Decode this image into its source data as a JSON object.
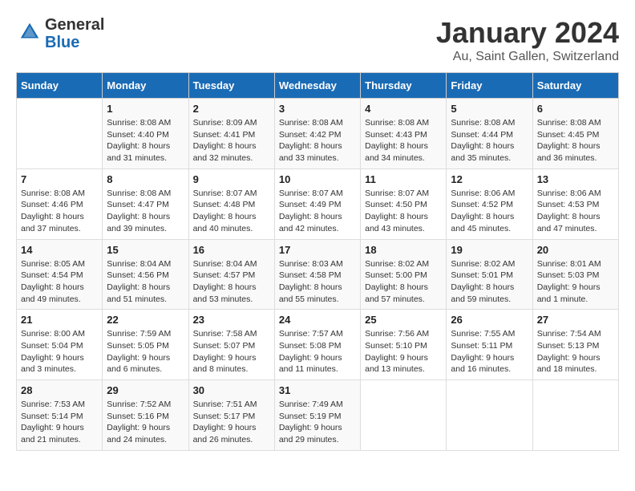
{
  "header": {
    "logo_line1": "General",
    "logo_line2": "Blue",
    "title": "January 2024",
    "subtitle": "Au, Saint Gallen, Switzerland"
  },
  "days_of_week": [
    "Sunday",
    "Monday",
    "Tuesday",
    "Wednesday",
    "Thursday",
    "Friday",
    "Saturday"
  ],
  "weeks": [
    [
      {
        "day": "",
        "sunrise": "",
        "sunset": "",
        "daylight": ""
      },
      {
        "day": "1",
        "sunrise": "Sunrise: 8:08 AM",
        "sunset": "Sunset: 4:40 PM",
        "daylight": "Daylight: 8 hours and 31 minutes."
      },
      {
        "day": "2",
        "sunrise": "Sunrise: 8:09 AM",
        "sunset": "Sunset: 4:41 PM",
        "daylight": "Daylight: 8 hours and 32 minutes."
      },
      {
        "day": "3",
        "sunrise": "Sunrise: 8:08 AM",
        "sunset": "Sunset: 4:42 PM",
        "daylight": "Daylight: 8 hours and 33 minutes."
      },
      {
        "day": "4",
        "sunrise": "Sunrise: 8:08 AM",
        "sunset": "Sunset: 4:43 PM",
        "daylight": "Daylight: 8 hours and 34 minutes."
      },
      {
        "day": "5",
        "sunrise": "Sunrise: 8:08 AM",
        "sunset": "Sunset: 4:44 PM",
        "daylight": "Daylight: 8 hours and 35 minutes."
      },
      {
        "day": "6",
        "sunrise": "Sunrise: 8:08 AM",
        "sunset": "Sunset: 4:45 PM",
        "daylight": "Daylight: 8 hours and 36 minutes."
      }
    ],
    [
      {
        "day": "7",
        "sunrise": "Sunrise: 8:08 AM",
        "sunset": "Sunset: 4:46 PM",
        "daylight": "Daylight: 8 hours and 37 minutes."
      },
      {
        "day": "8",
        "sunrise": "Sunrise: 8:08 AM",
        "sunset": "Sunset: 4:47 PM",
        "daylight": "Daylight: 8 hours and 39 minutes."
      },
      {
        "day": "9",
        "sunrise": "Sunrise: 8:07 AM",
        "sunset": "Sunset: 4:48 PM",
        "daylight": "Daylight: 8 hours and 40 minutes."
      },
      {
        "day": "10",
        "sunrise": "Sunrise: 8:07 AM",
        "sunset": "Sunset: 4:49 PM",
        "daylight": "Daylight: 8 hours and 42 minutes."
      },
      {
        "day": "11",
        "sunrise": "Sunrise: 8:07 AM",
        "sunset": "Sunset: 4:50 PM",
        "daylight": "Daylight: 8 hours and 43 minutes."
      },
      {
        "day": "12",
        "sunrise": "Sunrise: 8:06 AM",
        "sunset": "Sunset: 4:52 PM",
        "daylight": "Daylight: 8 hours and 45 minutes."
      },
      {
        "day": "13",
        "sunrise": "Sunrise: 8:06 AM",
        "sunset": "Sunset: 4:53 PM",
        "daylight": "Daylight: 8 hours and 47 minutes."
      }
    ],
    [
      {
        "day": "14",
        "sunrise": "Sunrise: 8:05 AM",
        "sunset": "Sunset: 4:54 PM",
        "daylight": "Daylight: 8 hours and 49 minutes."
      },
      {
        "day": "15",
        "sunrise": "Sunrise: 8:04 AM",
        "sunset": "Sunset: 4:56 PM",
        "daylight": "Daylight: 8 hours and 51 minutes."
      },
      {
        "day": "16",
        "sunrise": "Sunrise: 8:04 AM",
        "sunset": "Sunset: 4:57 PM",
        "daylight": "Daylight: 8 hours and 53 minutes."
      },
      {
        "day": "17",
        "sunrise": "Sunrise: 8:03 AM",
        "sunset": "Sunset: 4:58 PM",
        "daylight": "Daylight: 8 hours and 55 minutes."
      },
      {
        "day": "18",
        "sunrise": "Sunrise: 8:02 AM",
        "sunset": "Sunset: 5:00 PM",
        "daylight": "Daylight: 8 hours and 57 minutes."
      },
      {
        "day": "19",
        "sunrise": "Sunrise: 8:02 AM",
        "sunset": "Sunset: 5:01 PM",
        "daylight": "Daylight: 8 hours and 59 minutes."
      },
      {
        "day": "20",
        "sunrise": "Sunrise: 8:01 AM",
        "sunset": "Sunset: 5:03 PM",
        "daylight": "Daylight: 9 hours and 1 minute."
      }
    ],
    [
      {
        "day": "21",
        "sunrise": "Sunrise: 8:00 AM",
        "sunset": "Sunset: 5:04 PM",
        "daylight": "Daylight: 9 hours and 3 minutes."
      },
      {
        "day": "22",
        "sunrise": "Sunrise: 7:59 AM",
        "sunset": "Sunset: 5:05 PM",
        "daylight": "Daylight: 9 hours and 6 minutes."
      },
      {
        "day": "23",
        "sunrise": "Sunrise: 7:58 AM",
        "sunset": "Sunset: 5:07 PM",
        "daylight": "Daylight: 9 hours and 8 minutes."
      },
      {
        "day": "24",
        "sunrise": "Sunrise: 7:57 AM",
        "sunset": "Sunset: 5:08 PM",
        "daylight": "Daylight: 9 hours and 11 minutes."
      },
      {
        "day": "25",
        "sunrise": "Sunrise: 7:56 AM",
        "sunset": "Sunset: 5:10 PM",
        "daylight": "Daylight: 9 hours and 13 minutes."
      },
      {
        "day": "26",
        "sunrise": "Sunrise: 7:55 AM",
        "sunset": "Sunset: 5:11 PM",
        "daylight": "Daylight: 9 hours and 16 minutes."
      },
      {
        "day": "27",
        "sunrise": "Sunrise: 7:54 AM",
        "sunset": "Sunset: 5:13 PM",
        "daylight": "Daylight: 9 hours and 18 minutes."
      }
    ],
    [
      {
        "day": "28",
        "sunrise": "Sunrise: 7:53 AM",
        "sunset": "Sunset: 5:14 PM",
        "daylight": "Daylight: 9 hours and 21 minutes."
      },
      {
        "day": "29",
        "sunrise": "Sunrise: 7:52 AM",
        "sunset": "Sunset: 5:16 PM",
        "daylight": "Daylight: 9 hours and 24 minutes."
      },
      {
        "day": "30",
        "sunrise": "Sunrise: 7:51 AM",
        "sunset": "Sunset: 5:17 PM",
        "daylight": "Daylight: 9 hours and 26 minutes."
      },
      {
        "day": "31",
        "sunrise": "Sunrise: 7:49 AM",
        "sunset": "Sunset: 5:19 PM",
        "daylight": "Daylight: 9 hours and 29 minutes."
      },
      {
        "day": "",
        "sunrise": "",
        "sunset": "",
        "daylight": ""
      },
      {
        "day": "",
        "sunrise": "",
        "sunset": "",
        "daylight": ""
      },
      {
        "day": "",
        "sunrise": "",
        "sunset": "",
        "daylight": ""
      }
    ]
  ]
}
